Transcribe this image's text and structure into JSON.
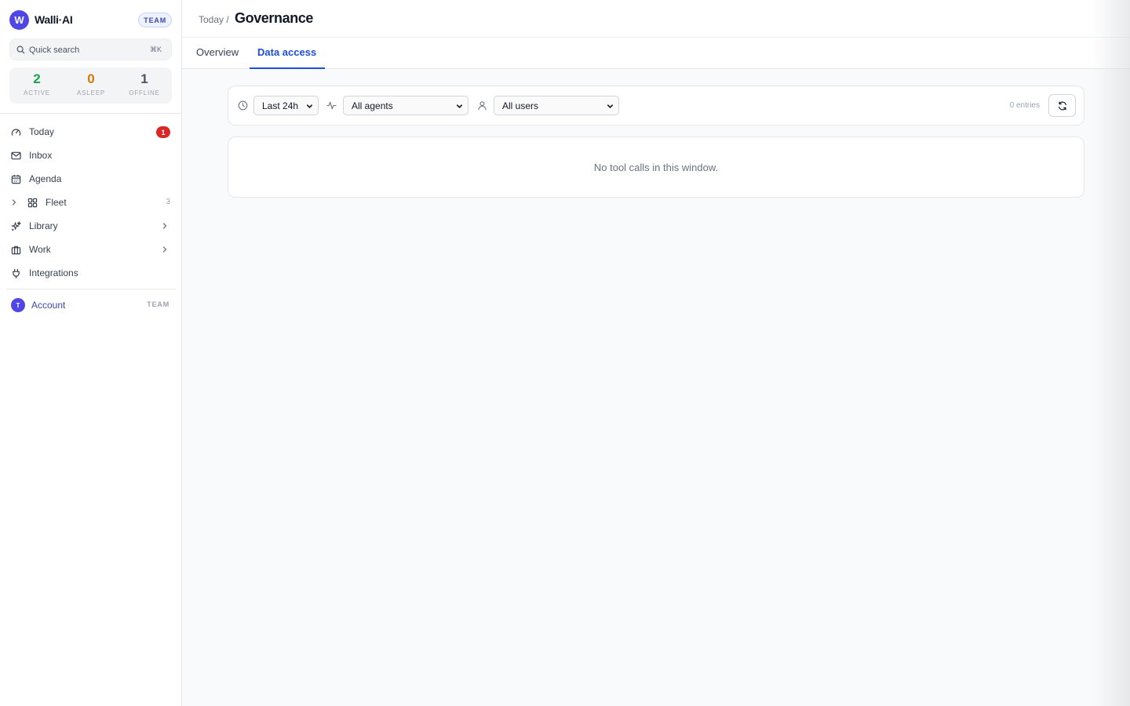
{
  "brand": {
    "logo_letter": "W",
    "name": "Walli·AI",
    "plan": "TEAM"
  },
  "search": {
    "placeholder": "Quick search",
    "shortcut": "⌘K"
  },
  "stats": [
    {
      "value": "2",
      "label": "ACTIVE",
      "color": "#16a34a"
    },
    {
      "value": "0",
      "label": "ASLEEP",
      "color": "#d97706"
    },
    {
      "value": "1",
      "label": "OFFLINE",
      "color": "#4b5563"
    }
  ],
  "nav": {
    "items": [
      {
        "label": "Today",
        "icon": "gauge-icon",
        "badge": "1"
      },
      {
        "label": "Inbox",
        "icon": "mail-icon"
      },
      {
        "label": "Agenda",
        "icon": "calendar-icon"
      },
      {
        "label": "Fleet",
        "icon": "grid-icon",
        "count": "3"
      },
      {
        "label": "Library",
        "icon": "sparkles-icon"
      },
      {
        "label": "Work",
        "icon": "briefcase-icon"
      },
      {
        "label": "Integrations",
        "icon": "plug-icon"
      }
    ]
  },
  "account": {
    "avatar_letter": "T",
    "label": "Account",
    "plan": "TEAM"
  },
  "header": {
    "breadcrumb": "Today /",
    "title": "Governance"
  },
  "tabs": [
    {
      "label": "Overview",
      "active": false
    },
    {
      "label": "Data access",
      "active": true
    }
  ],
  "filters": {
    "time_range": "Last 24h",
    "agents": "All agents",
    "users": "All users",
    "entries": "0 entries"
  },
  "empty_state": {
    "message": "No tool calls in this window."
  },
  "colors": {
    "accent": "#1d4ed8",
    "brand": "#4f46e5",
    "badge": "#dc2626"
  }
}
